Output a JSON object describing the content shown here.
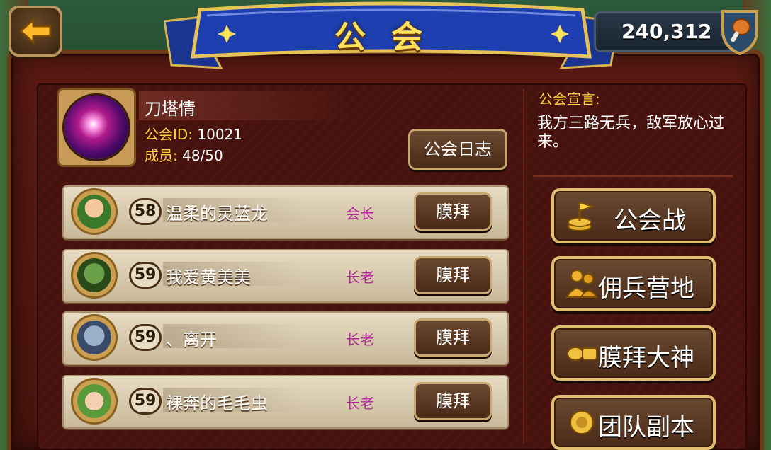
{
  "header": {
    "title": "公会",
    "currency": "240,312"
  },
  "guild": {
    "name": "刀塔情",
    "id_label": "公会ID: ",
    "id_value": "10021",
    "members_label": "成员: ",
    "members_value": "48/50",
    "log_button": "公会日志"
  },
  "declaration": {
    "title": "公会宣言:",
    "text": "我方三路无兵，敌军放心过来。"
  },
  "members": [
    {
      "level": "58",
      "name": "温柔的灵蓝龙",
      "role": "会长",
      "action": "膜拜"
    },
    {
      "level": "59",
      "name": "我爱黄美美",
      "role": "长老",
      "action": "膜拜"
    },
    {
      "level": "59",
      "name": "、离开",
      "role": "长老",
      "action": "膜拜"
    },
    {
      "level": "59",
      "name": "裸奔的毛毛虫",
      "role": "长老",
      "action": "膜拜"
    }
  ],
  "side_buttons": [
    {
      "label": "公会战",
      "icon": "coin-flag-icon"
    },
    {
      "label": "佣兵营地",
      "icon": "mercenary-icon"
    },
    {
      "label": "膜拜大神",
      "icon": "worship-coin-icon"
    },
    {
      "label": "团队副本",
      "icon": "team-dungeon-icon"
    }
  ],
  "colors": {
    "gold_text": "#ffd23c",
    "role_text": "#b02a9a",
    "banner_blue": "#1d3fb0"
  }
}
